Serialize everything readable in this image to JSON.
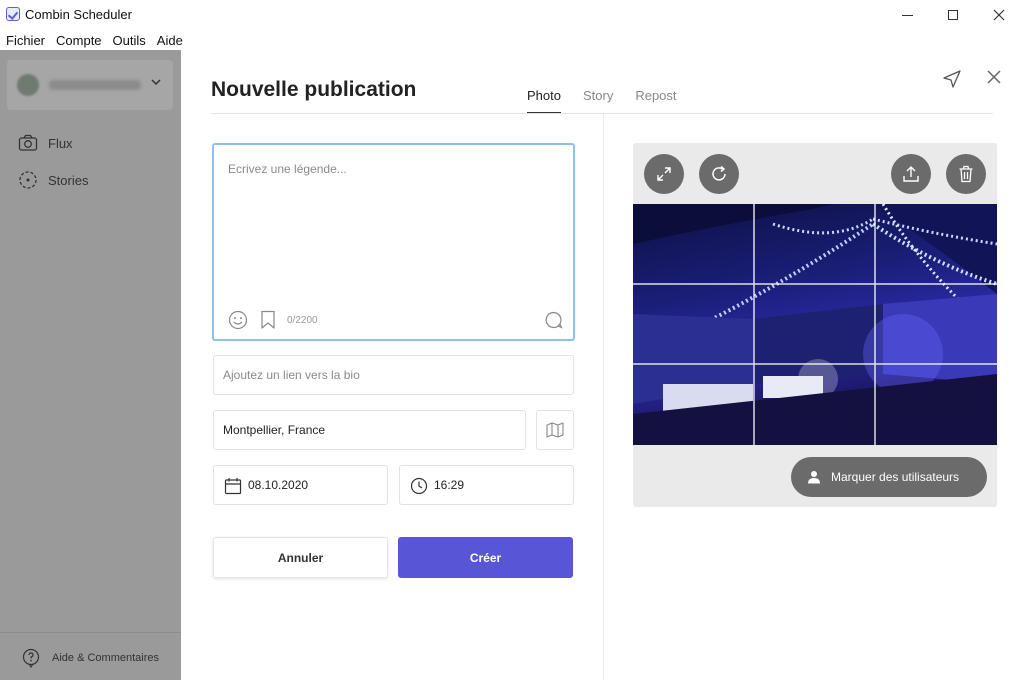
{
  "window": {
    "title": "Combin Scheduler"
  },
  "menu": [
    "Fichier",
    "Compte",
    "Outils",
    "Aide"
  ],
  "sidebar": {
    "items": [
      {
        "label": "Flux",
        "icon": "camera-icon"
      },
      {
        "label": "Stories",
        "icon": "stories-icon"
      }
    ],
    "footer": {
      "label": "Aide & Commentaires",
      "icon": "help-icon"
    }
  },
  "modal": {
    "title": "Nouvelle publication",
    "tabs": [
      {
        "label": "Photo",
        "active": true
      },
      {
        "label": "Story",
        "active": false
      },
      {
        "label": "Repost",
        "active": false
      }
    ],
    "caption": {
      "placeholder": "Ecrivez une légende...",
      "value": "",
      "char_count": "0/2200"
    },
    "bio_link": {
      "placeholder": "Ajoutez un lien vers la bio",
      "value": ""
    },
    "location": {
      "value": "Montpellier, France"
    },
    "date": {
      "value": "08.10.2020"
    },
    "time": {
      "value": "16:29"
    },
    "buttons": {
      "cancel": "Annuler",
      "create": "Créer"
    },
    "preview": {
      "tag_button": "Marquer des utilisateurs"
    }
  },
  "colors": {
    "accent": "#5856d6",
    "focus_border": "#8fbfea",
    "overlay_button": "#6b6b6b",
    "sidebar_dimmed": "#9a9a9a"
  }
}
